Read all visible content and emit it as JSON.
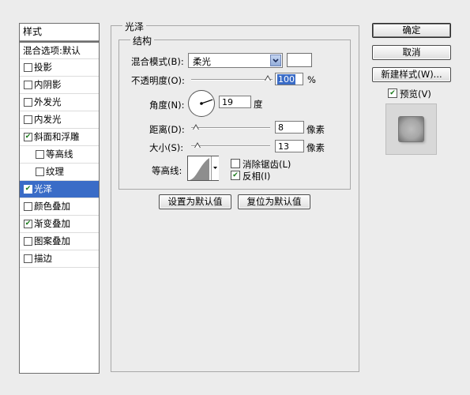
{
  "style_panel": {
    "header": "样式",
    "blend_options": "混合选项:默认",
    "items": [
      {
        "label": "投影",
        "checked": false,
        "indent": 0
      },
      {
        "label": "内阴影",
        "checked": false,
        "indent": 0
      },
      {
        "label": "外发光",
        "checked": false,
        "indent": 0
      },
      {
        "label": "内发光",
        "checked": false,
        "indent": 0
      },
      {
        "label": "斜面和浮雕",
        "checked": true,
        "indent": 0
      },
      {
        "label": "等高线",
        "checked": false,
        "indent": 1
      },
      {
        "label": "纹理",
        "checked": false,
        "indent": 1
      },
      {
        "label": "光泽",
        "checked": true,
        "indent": 0,
        "selected": true
      },
      {
        "label": "颜色叠加",
        "checked": false,
        "indent": 0
      },
      {
        "label": "渐变叠加",
        "checked": true,
        "indent": 0
      },
      {
        "label": "图案叠加",
        "checked": false,
        "indent": 0
      },
      {
        "label": "描边",
        "checked": false,
        "indent": 0
      }
    ]
  },
  "satin": {
    "group_title": "光泽",
    "structure_title": "结构",
    "blend_mode_label": "混合模式(B):",
    "blend_mode_value": "柔光",
    "opacity_label": "不透明度(O):",
    "opacity_value": "100",
    "opacity_unit": "%",
    "opacity_fraction": 1.0,
    "angle_label": "角度(N):",
    "angle_value": "19",
    "angle_unit": "度",
    "angle_degrees": 19,
    "distance_label": "距离(D):",
    "distance_value": "8",
    "distance_unit": "像素",
    "distance_fraction": 0.04,
    "size_label": "大小(S):",
    "size_value": "13",
    "size_unit": "像素",
    "size_fraction": 0.06,
    "contour_label": "等高线:",
    "anti_alias_label": "消除锯齿(L)",
    "anti_alias_checked": false,
    "invert_label": "反相(I)",
    "invert_checked": true,
    "make_default_label": "设置为默认值",
    "reset_default_label": "复位为默认值"
  },
  "buttons": {
    "ok": "确定",
    "cancel": "取消",
    "new_style": "新建样式(W)...",
    "preview_label": "预览(V)",
    "preview_checked": true
  },
  "colors": {
    "selection": "#3a6cc7",
    "satin_color": "#ffffff",
    "check_mark": "#1a7a1a"
  }
}
